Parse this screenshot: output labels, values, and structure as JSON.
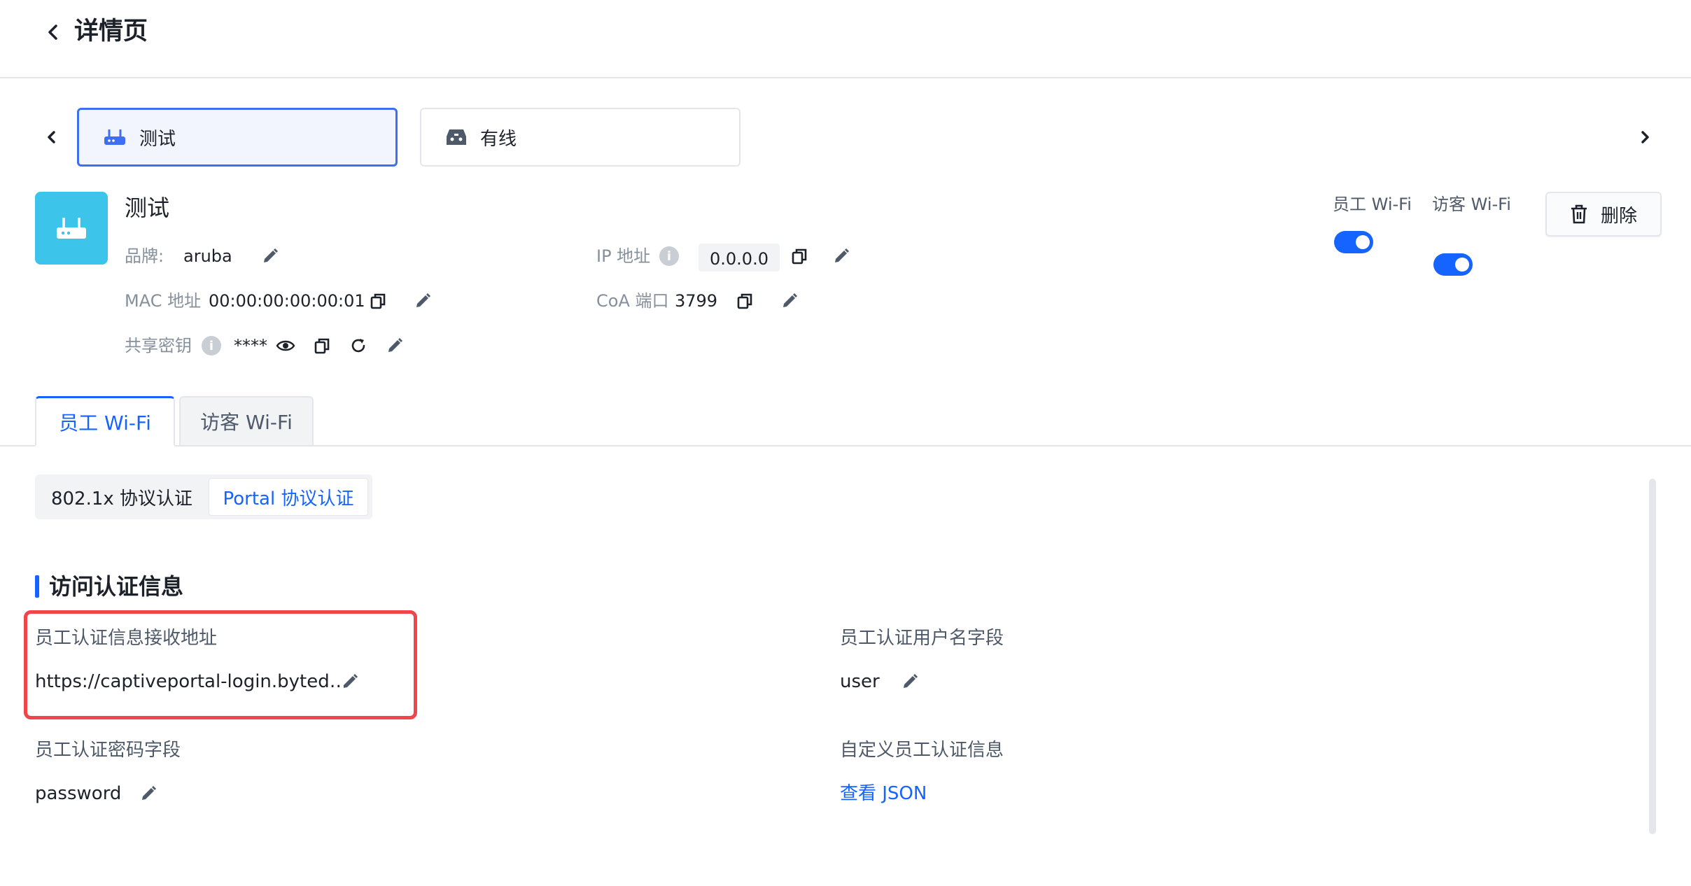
{
  "header": {
    "title": "详情页"
  },
  "devices": [
    {
      "name": "测试",
      "icon": "router-icon",
      "selected": true
    },
    {
      "name": "有线",
      "icon": "wired-switch-icon",
      "selected": false
    }
  ],
  "device": {
    "name": "测试",
    "brand_label": "品牌:",
    "brand_value": "aruba",
    "mac_label": "MAC 地址",
    "mac_value": "00:00:00:00:00:01",
    "secret_label": "共享密钥",
    "secret_value": "****",
    "ip_label": "IP 地址",
    "ip_value": "0.0.0.0",
    "coa_label": "CoA 端口",
    "coa_value": "3799",
    "info_glyph": "i"
  },
  "toggles": [
    {
      "label": "员工 Wi-Fi",
      "on": true
    },
    {
      "label": "访客 Wi-Fi",
      "on": true
    }
  ],
  "actions": {
    "delete_label": "删除"
  },
  "tabs": [
    {
      "label": "员工 Wi-Fi",
      "active": true
    },
    {
      "label": "访客 Wi-Fi",
      "active": false
    }
  ],
  "auth_modes": [
    {
      "label": "802.1x 协议认证",
      "active": false
    },
    {
      "label": "Portal 协议认证",
      "active": true
    }
  ],
  "section": {
    "title": "访问认证信息",
    "fields": {
      "receive_url": {
        "label": "员工认证信息接收地址",
        "value": "https://captiveportal-login.byted…"
      },
      "username_field": {
        "label": "员工认证用户名字段",
        "value": "user"
      },
      "password_field": {
        "label": "员工认证密码字段",
        "value": "password"
      },
      "custom_info": {
        "label": "自定义员工认证信息",
        "link": "查看 JSON"
      }
    }
  },
  "colors": {
    "primary": "#1664ff",
    "avatar_bg": "#3cc4ea",
    "highlight": "#f0454a",
    "muted_text": "#86909c"
  }
}
